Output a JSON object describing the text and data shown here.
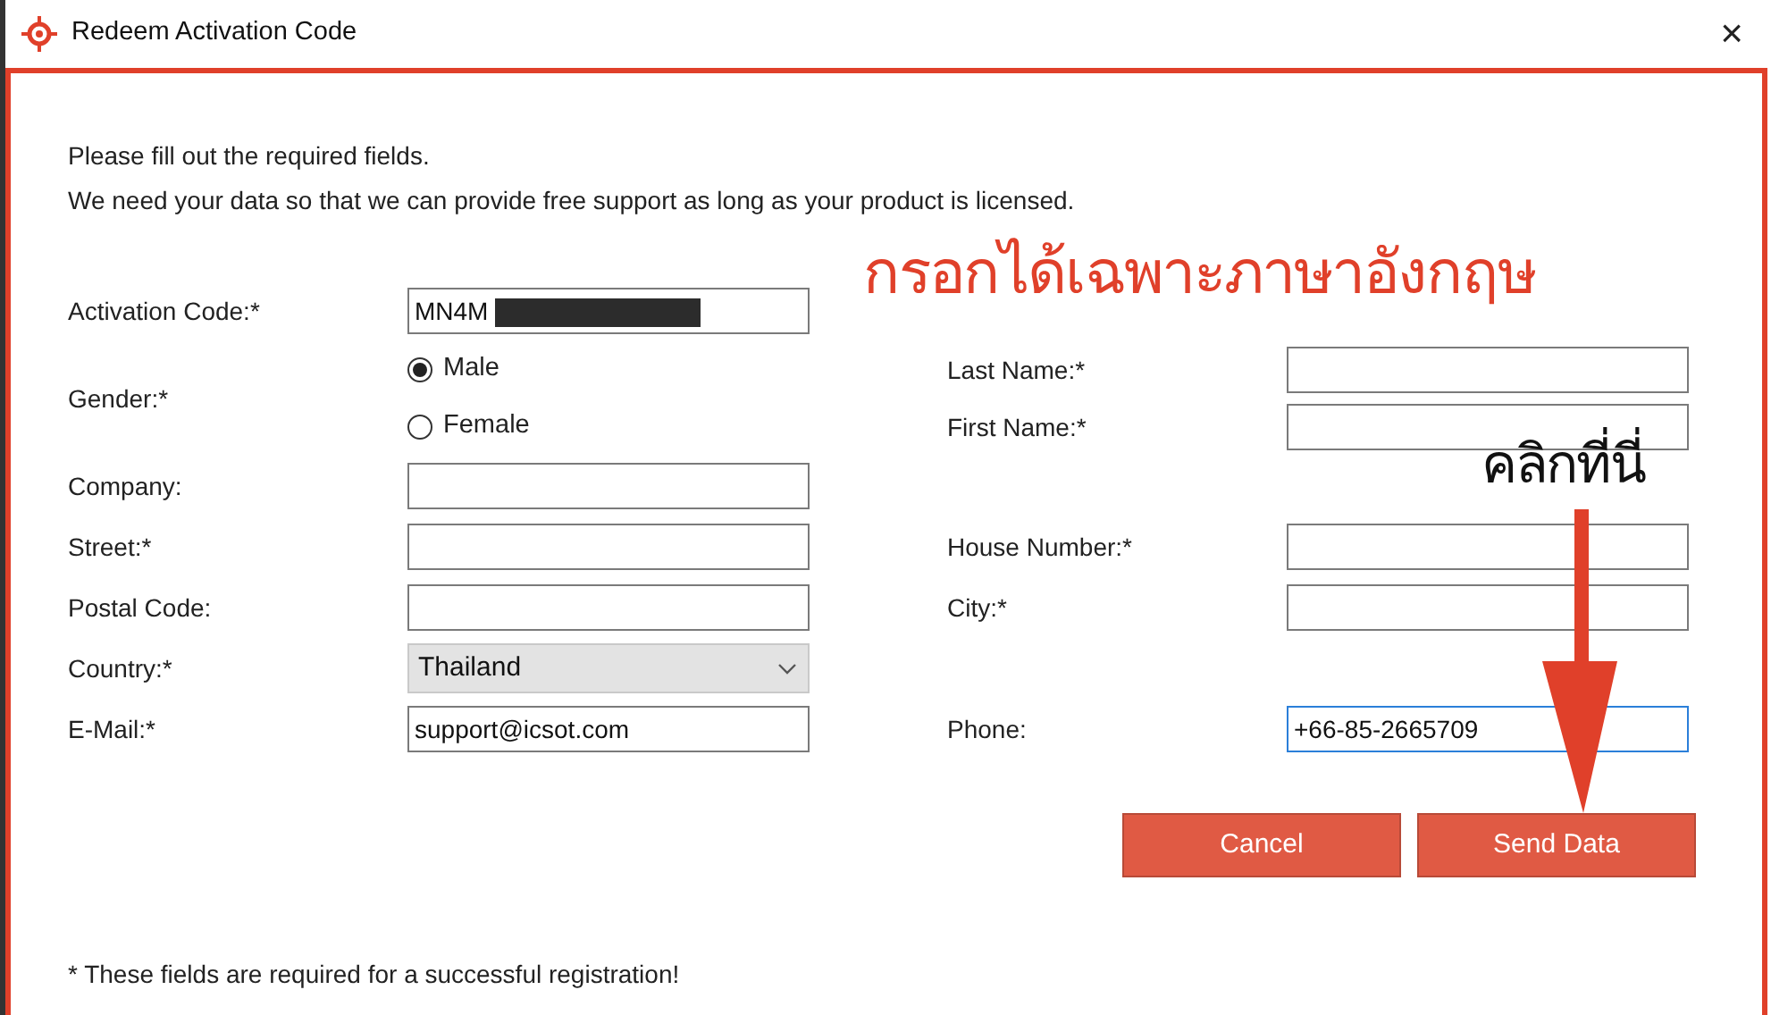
{
  "window": {
    "title": "Redeem Activation Code",
    "close": "×"
  },
  "intro": [
    "Please fill out the required fields.",
    "We need your data so that we can provide free support as long as your product is licensed."
  ],
  "rows": [
    {
      "left": {
        "label": "Activation Code:*",
        "kind": "text",
        "value": "MN4M",
        "redacted": true
      },
      "right": []
    },
    {
      "left": {
        "label": "Gender:*",
        "kind": "radio",
        "options": [
          {
            "label": "Male",
            "selected": true
          },
          {
            "label": "Female",
            "selected": false
          }
        ]
      },
      "right": [
        {
          "label": "Last Name:*",
          "kind": "text"
        },
        {
          "label": "First Name:*",
          "kind": "text"
        }
      ]
    },
    {
      "left": {
        "label": "Company:",
        "kind": "text"
      },
      "right": []
    },
    {
      "left": {
        "label": "Street:*",
        "kind": "text"
      },
      "right": [
        {
          "label": "House Number:*",
          "kind": "text"
        }
      ]
    },
    {
      "left": {
        "label": "Postal Code:",
        "kind": "text"
      },
      "right": [
        {
          "label": "City:*",
          "kind": "text"
        }
      ]
    },
    {
      "left": {
        "label": "Country:*",
        "kind": "select",
        "value": "Thailand"
      },
      "right": []
    },
    {
      "left": {
        "label": "E-Mail:*",
        "kind": "text",
        "value": "support@icsot.com"
      },
      "right": [
        {
          "label": "Phone:",
          "kind": "text",
          "value": "+66-85-2665709",
          "focused": true
        }
      ]
    }
  ],
  "buttons": [
    {
      "label": "Cancel"
    },
    {
      "label": "Send Data"
    }
  ],
  "footnote": "* These fields are required for a successful registration!",
  "annotations": {
    "note": "กรอกได้เฉพาะภาษาอังกฤษ",
    "click_here": "คลิกที่นี่"
  }
}
